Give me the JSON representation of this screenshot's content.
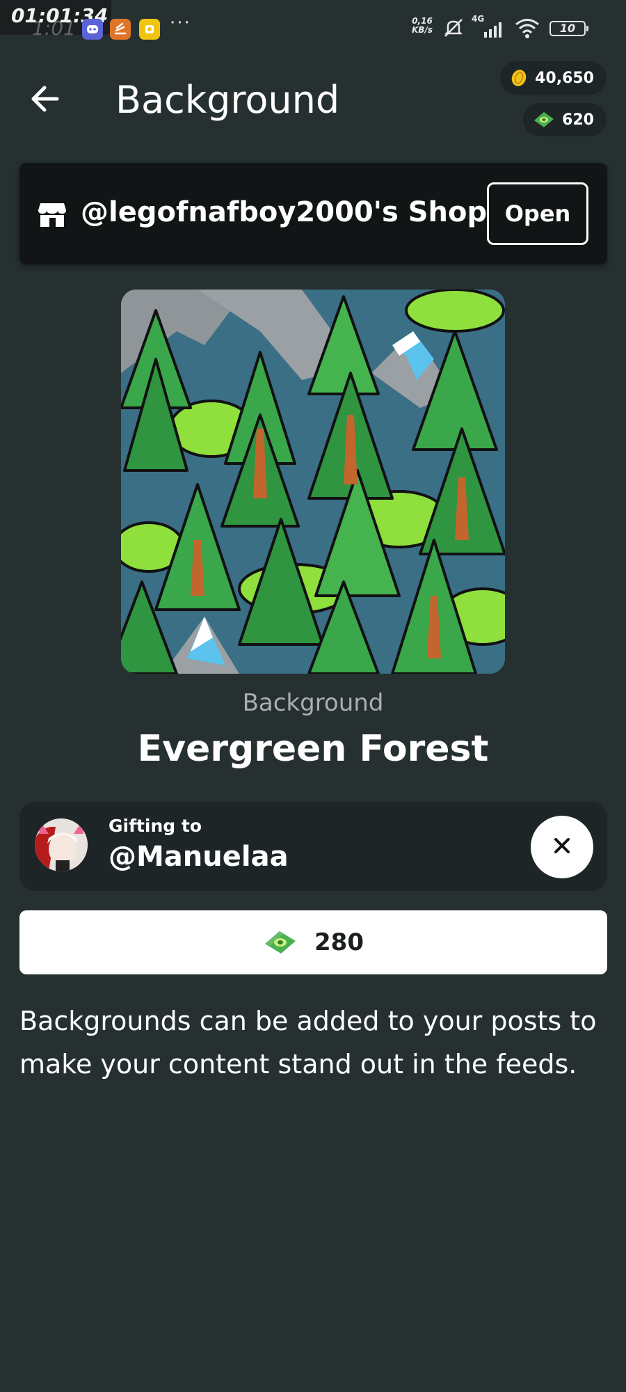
{
  "status_bar": {
    "time": "01:01:34",
    "ghost_time": "1:01",
    "network_speed_top": "0,16",
    "network_speed_unit": "KB/s",
    "signal_label": "4G",
    "battery": "10",
    "more": "···"
  },
  "header": {
    "title": "Background"
  },
  "wallet": {
    "coins": "40,650",
    "cash": "620"
  },
  "shop": {
    "name": "@legofnafboy2000's Shop",
    "open_label": "Open"
  },
  "item": {
    "category": "Background",
    "title": "Evergreen Forest"
  },
  "gifting": {
    "label": "Gifting to",
    "username": "@Manuelaa"
  },
  "purchase": {
    "price": "280"
  },
  "description": "Backgrounds can be added to your posts to make your content stand out in the feeds.",
  "colors": {
    "background": "#263031",
    "card": "#1d2527",
    "banner": "#111516",
    "accent_green": "#4caf50",
    "coin_gold": "#f3c21a"
  }
}
